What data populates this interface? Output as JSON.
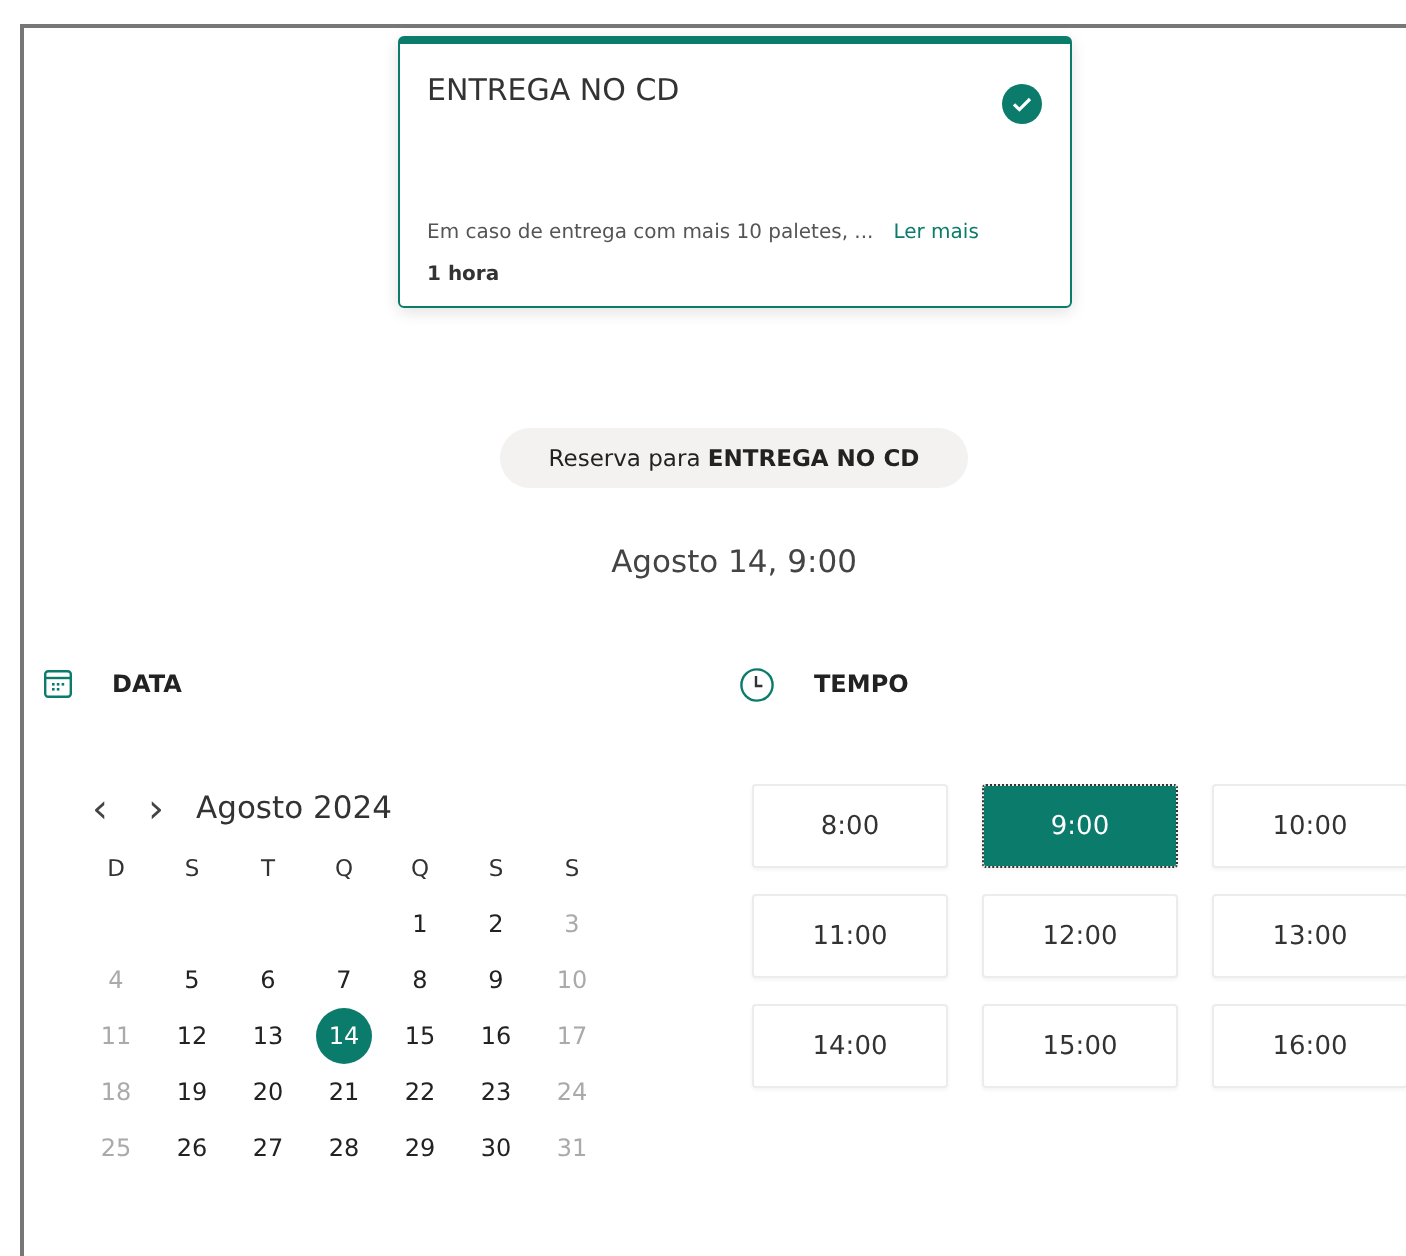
{
  "service_card": {
    "title": "ENTREGA NO CD",
    "selected": true,
    "description": "Em caso de entrega com mais 10 paletes, ...",
    "link": "Ler mais",
    "duration": "1 hora"
  },
  "booking_pill": "Reserva para **ENTREGA NO CD**",
  "selected_datetime": "Agosto 14, 9:00",
  "date_section": {
    "heading": "DATA",
    "month": "Agosto 2024",
    "prev": "‹",
    "next": "›",
    "weekdays": [
      "D",
      "S",
      "T",
      "Q",
      "Q",
      "S",
      "S"
    ],
    "weeks": [
      [
        {
          "day": "1",
          "disabled": false,
          "selected": false
        },
        {
          "day": "2",
          "disabled": false,
          "selected": false
        },
        {
          "day": "3",
          "disabled": true,
          "selected": false
        }
      ],
      [
        {
          "day": "4",
          "disabled": true,
          "selected": false
        },
        {
          "day": "5",
          "disabled": false,
          "selected": false
        },
        {
          "day": "6",
          "disabled": false,
          "selected": false
        },
        {
          "day": "7",
          "disabled": false,
          "selected": false
        },
        {
          "day": "8",
          "disabled": false,
          "selected": false
        },
        {
          "day": "9",
          "disabled": false,
          "selected": false
        },
        {
          "day": "10",
          "disabled": true,
          "selected": false
        }
      ],
      [
        {
          "day": "11",
          "disabled": true,
          "selected": false
        },
        {
          "day": "12",
          "disabled": false,
          "selected": false
        },
        {
          "day": "13",
          "disabled": false,
          "selected": false
        },
        {
          "day": "14",
          "disabled": false,
          "selected": true
        },
        {
          "day": "15",
          "disabled": false,
          "selected": false
        },
        {
          "day": "16",
          "disabled": false,
          "selected": false
        },
        {
          "day": "17",
          "disabled": true,
          "selected": false
        }
      ],
      [
        {
          "day": "18",
          "disabled": true,
          "selected": false
        },
        {
          "day": "19",
          "disabled": false,
          "selected": false
        },
        {
          "day": "20",
          "disabled": false,
          "selected": false
        },
        {
          "day": "21",
          "disabled": false,
          "selected": false
        },
        {
          "day": "22",
          "disabled": false,
          "selected": false
        },
        {
          "day": "23",
          "disabled": false,
          "selected": false
        },
        {
          "day": "24",
          "disabled": true,
          "selected": false
        }
      ],
      [
        {
          "day": "25",
          "disabled": true,
          "selected": false
        },
        {
          "day": "26",
          "disabled": false,
          "selected": false
        },
        {
          "day": "27",
          "disabled": false,
          "selected": false
        },
        {
          "day": "28",
          "disabled": false,
          "selected": false
        },
        {
          "day": "29",
          "disabled": false,
          "selected": false
        },
        {
          "day": "30",
          "disabled": false,
          "selected": false
        },
        {
          "day": "31",
          "disabled": true,
          "selected": false
        }
      ]
    ]
  },
  "time_section": {
    "heading": "TEMPO",
    "slots": [
      {
        "time": "8:00",
        "selected": false
      },
      {
        "time": "9:00",
        "selected": true
      },
      {
        "time": "10:00",
        "selected": false
      },
      {
        "time": "11:00",
        "selected": false
      },
      {
        "time": "12:00",
        "selected": false
      },
      {
        "time": "13:00",
        "selected": false
      },
      {
        "time": "14:00",
        "selected": false
      },
      {
        "time": "15:00",
        "selected": false
      },
      {
        "time": "16:00",
        "selected": false
      }
    ]
  }
}
